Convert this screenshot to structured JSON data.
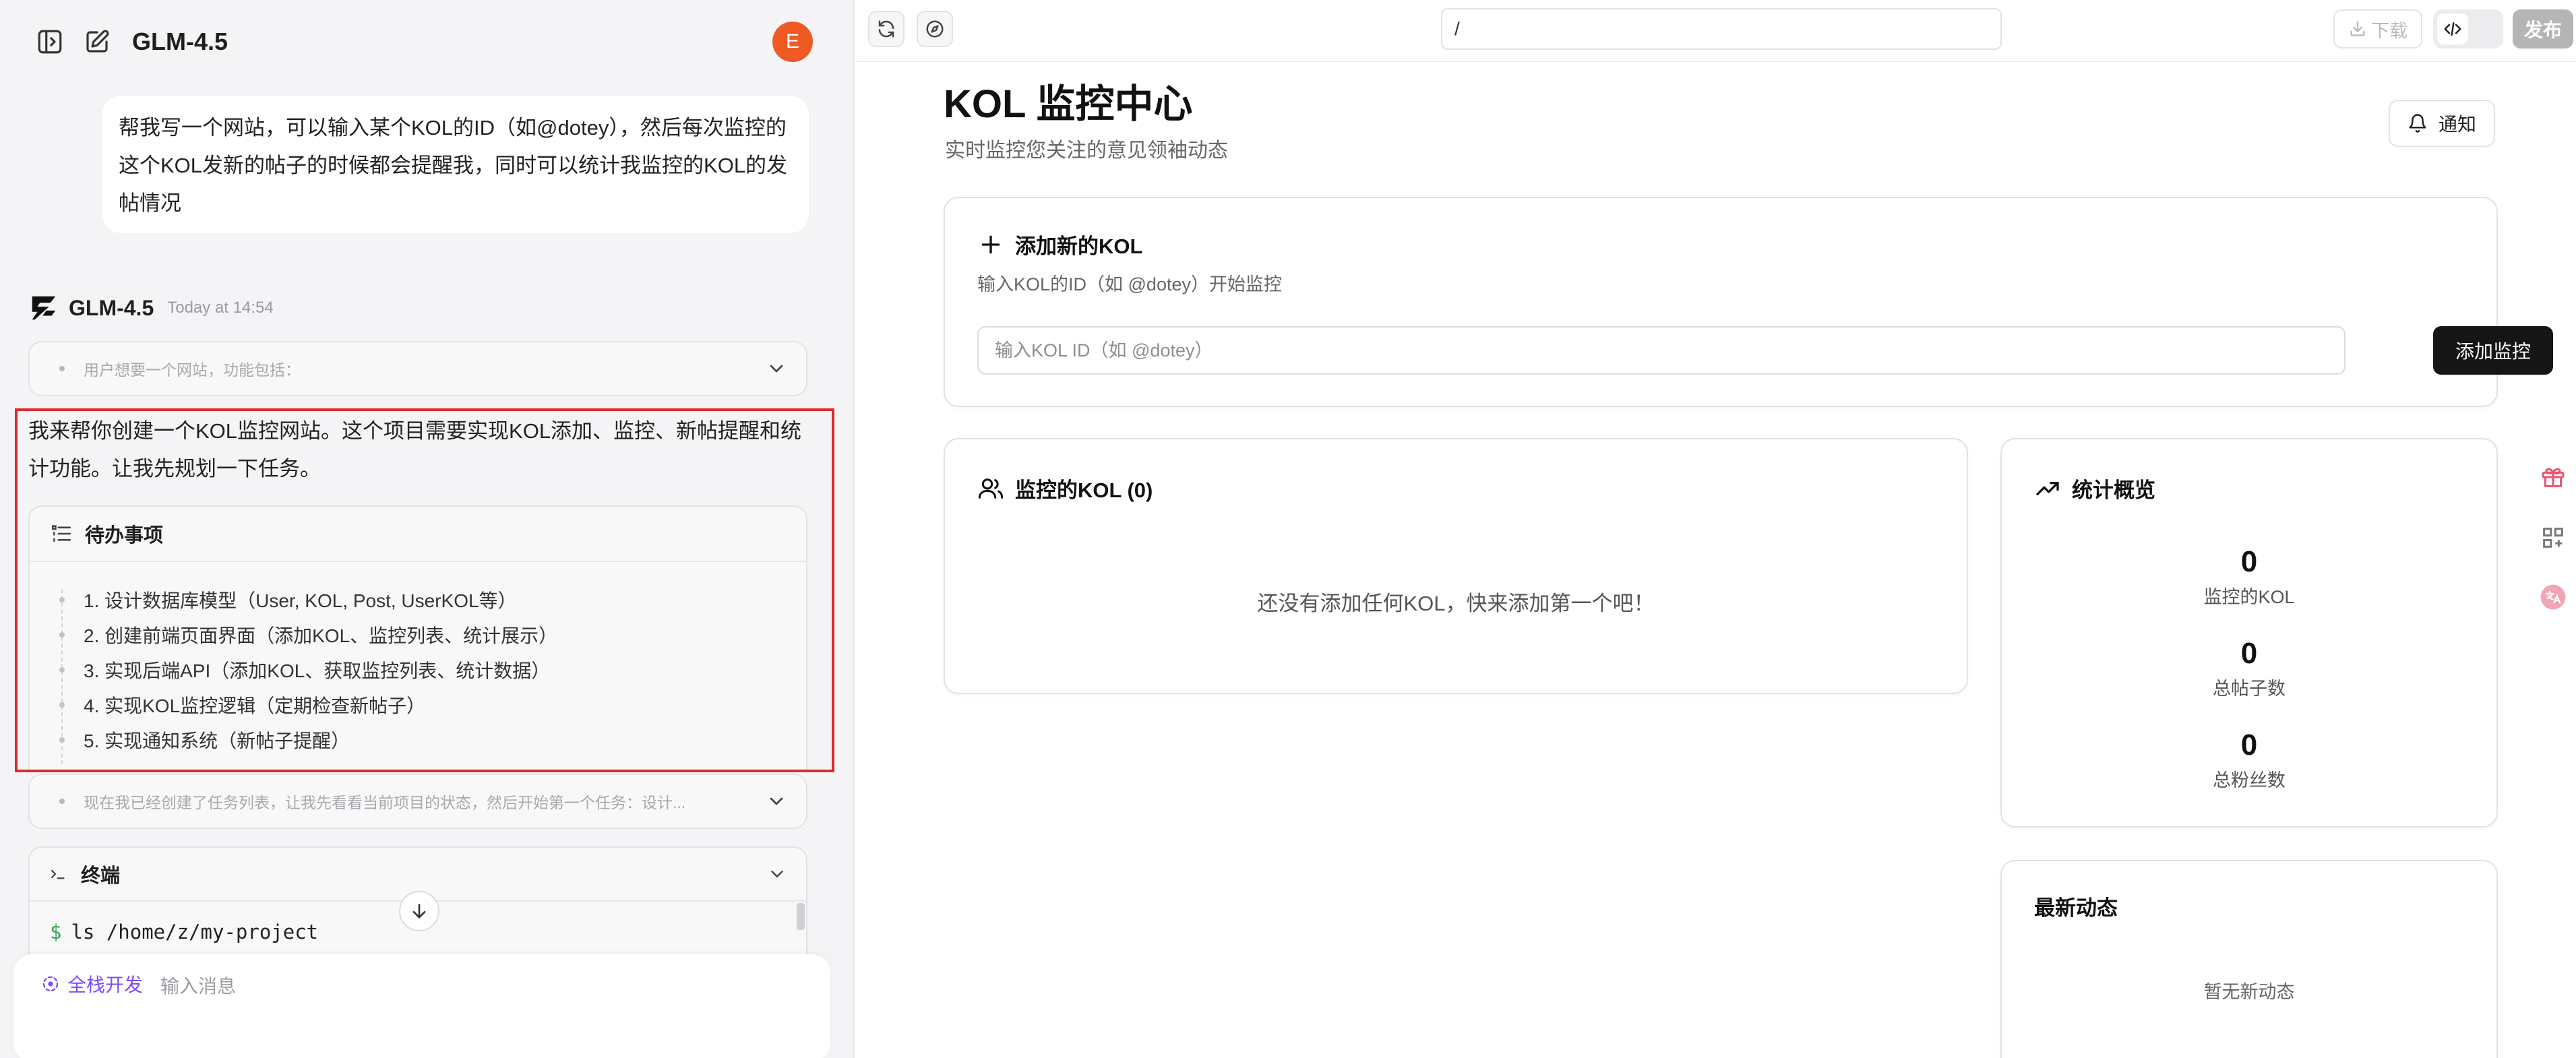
{
  "left": {
    "model_name": "GLM-4.5",
    "user_avatar": "E",
    "user_message": "帮我写一个网站，可以输入某个KOL的ID（如@dotey），然后每次监控的这个KOL发新的帖子的时候都会提醒我，同时可以统计我监控的KOL的发帖情况",
    "assistant": {
      "name": "GLM-4.5",
      "time": "Today at 14:54",
      "thinking_1": "用户想要一个网站，功能包括：",
      "answer": "我来帮你创建一个KOL监控网站。这个项目需要实现KOL添加、监控、新帖提醒和统计功能。让我先规划一下任务。",
      "todo_title": "待办事项",
      "todos": [
        "1. 设计数据库模型（User, KOL, Post, UserKOL等）",
        "2. 创建前端页面界面（添加KOL、监控列表、统计展示）",
        "3. 实现后端API（添加KOL、获取监控列表、统计数据）",
        "4. 实现KOL监控逻辑（定期检查新帖子）",
        "5. 实现通知系统（新帖子提醒）"
      ],
      "thinking_2": "现在我已经创建了任务列表，让我先看看当前项目的状态，然后开始第一个任务：设计..."
    },
    "terminal": {
      "title": "终端",
      "prompt": "$",
      "command": "ls /home/z/my-project"
    },
    "input": {
      "mode_label": "全栈开发",
      "placeholder": "输入消息"
    }
  },
  "right": {
    "url": "/",
    "download_label": "下载",
    "publish_label": "发布",
    "page_title": "KOL 监控中心",
    "page_subtitle": "实时监控您关注的意见领袖动态",
    "notify_label": "通知",
    "add_card": {
      "title": "添加新的KOL",
      "hint": "输入KOL的ID（如 @dotey）开始监控",
      "input_placeholder": "输入KOL ID（如 @dotey）",
      "button_label": "添加监控"
    },
    "monitor_card": {
      "title": "监控的KOL (0)",
      "empty_message": "还没有添加任何KOL，快来添加第一个吧！"
    },
    "stats_card": {
      "title": "统计概览",
      "stats": [
        {
          "value": "0",
          "label": "监控的KOL"
        },
        {
          "value": "0",
          "label": "总帖子数"
        },
        {
          "value": "0",
          "label": "总粉丝数"
        }
      ]
    },
    "activity_card": {
      "title": "最新动态",
      "empty_message": "暂无新动态"
    }
  },
  "colors": {
    "avatar": "#ef5a24",
    "highlight_border": "#d92d2d",
    "mode_accent": "#7b4dff",
    "primary_button": "#161616",
    "terminal_prompt": "#2fa84f"
  }
}
